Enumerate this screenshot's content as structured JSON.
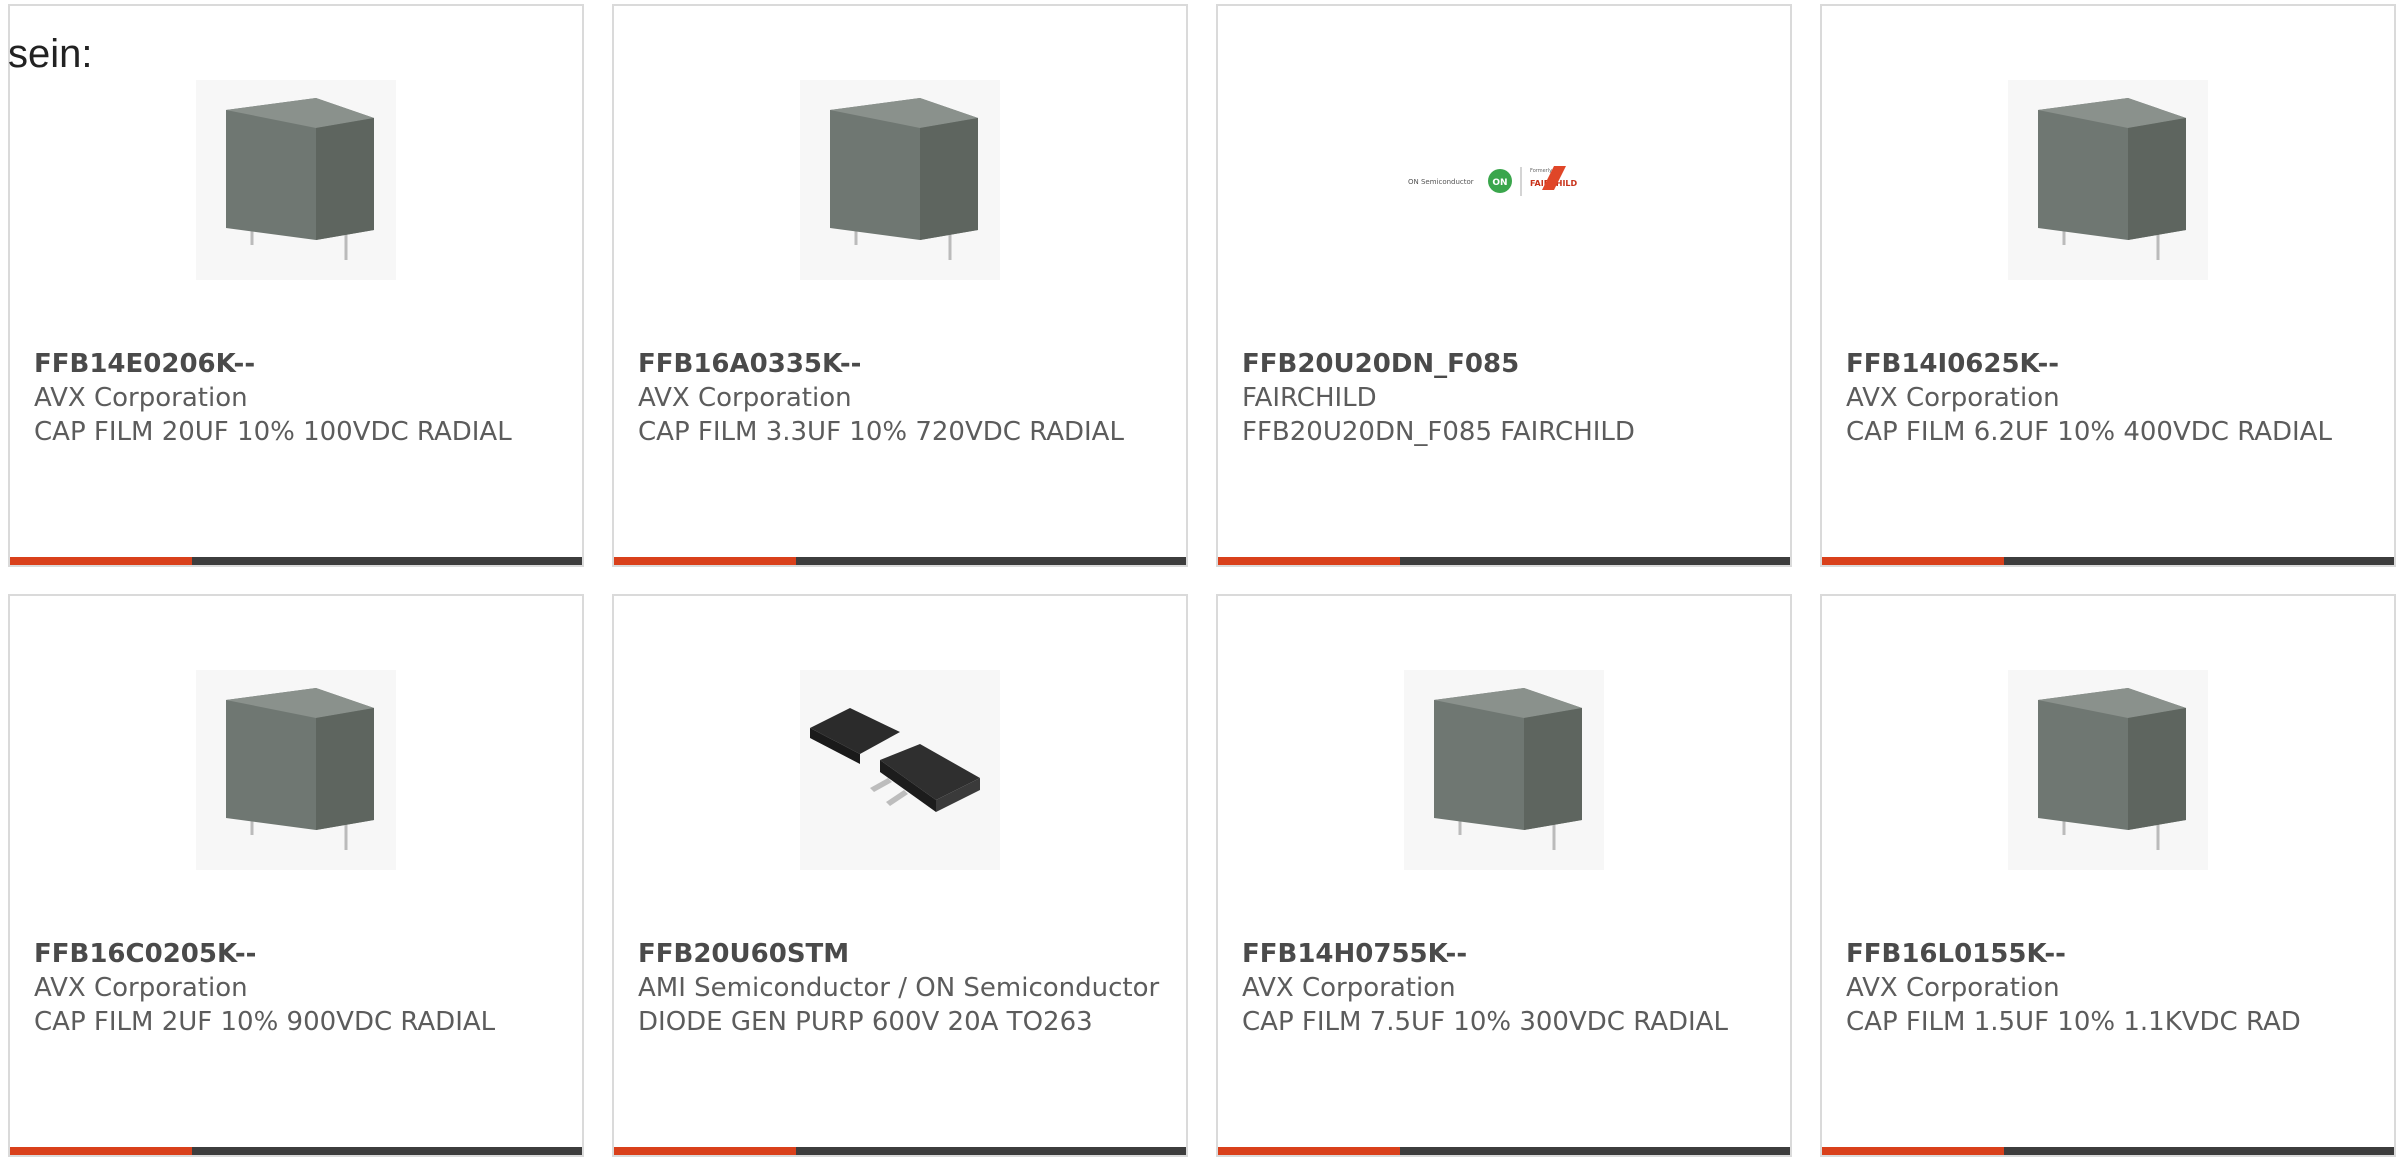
{
  "intro_text": "sein:",
  "colors": {
    "accent": "#d9401b",
    "bar_dark": "#3d3d3d",
    "border": "#dadada"
  },
  "products": [
    {
      "part_number": "FFB14E0206K--",
      "manufacturer": "AVX Corporation",
      "description": "CAP FILM 20UF 10% 100VDC RADIAL",
      "image_icon": "film-capacitor-icon"
    },
    {
      "part_number": "FFB16A0335K--",
      "manufacturer": "AVX Corporation",
      "description": "CAP FILM 3.3UF 10% 720VDC RADIAL",
      "image_icon": "film-capacitor-icon"
    },
    {
      "part_number": "FFB20U20DN_F085",
      "manufacturer": "FAIRCHILD",
      "description": "FFB20U20DN_F085 FAIRCHILD",
      "image_icon": "on-semiconductor-fairchild-logo",
      "logo_text": {
        "left": "ON Semiconductor",
        "badge": "ON",
        "formerly": "Formerly",
        "brand": "FAIRCHILD"
      }
    },
    {
      "part_number": "FFB14I0625K--",
      "manufacturer": "AVX Corporation",
      "description": "CAP FILM 6.2UF 10% 400VDC RADIAL",
      "image_icon": "film-capacitor-icon"
    },
    {
      "part_number": "FFB16C0205K--",
      "manufacturer": "AVX Corporation",
      "description": "CAP FILM 2UF 10% 900VDC RADIAL",
      "image_icon": "film-capacitor-icon"
    },
    {
      "part_number": "FFB20U60STM",
      "manufacturer": "AMI Semiconductor / ON Semiconductor",
      "description": "DIODE GEN PURP 600V 20A TO263",
      "image_icon": "to263-package-icon"
    },
    {
      "part_number": "FFB14H0755K--",
      "manufacturer": "AVX Corporation",
      "description": "CAP FILM 7.5UF 10% 300VDC RADIAL",
      "image_icon": "film-capacitor-icon"
    },
    {
      "part_number": "FFB16L0155K--",
      "manufacturer": "AVX Corporation",
      "description": "CAP FILM 1.5UF 10% 1.1KVDC RAD",
      "image_icon": "film-capacitor-icon"
    }
  ]
}
